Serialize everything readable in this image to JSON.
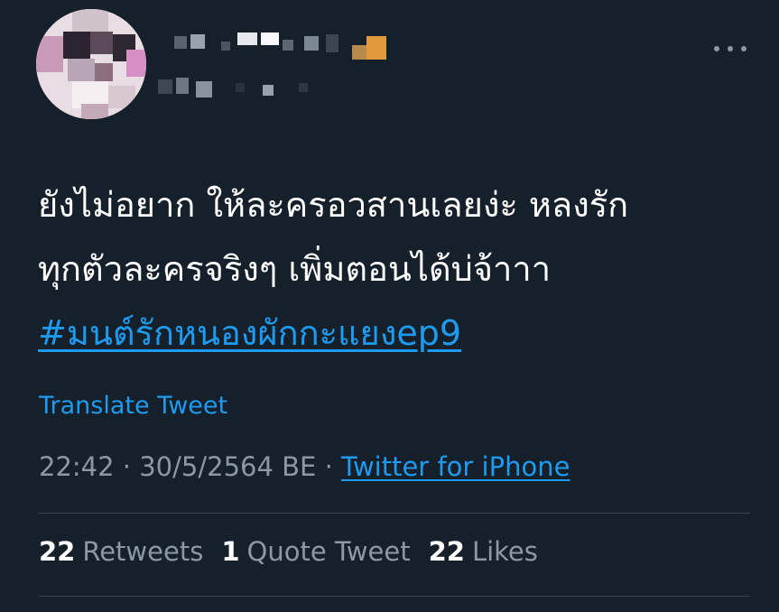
{
  "tweet": {
    "text_lines": [
      "ยังไม่อยาก ให้ละครอวสานเลยง่ะ หลงรัก",
      "ทุกตัวละครจริงๆ เพิ่มตอนได้บ่จ้าาา"
    ],
    "hashtag": "#มนต์รักหนองผักกะแยงep9"
  },
  "translate_label": "Translate Tweet",
  "meta": {
    "time": "22:42",
    "sep1": " · ",
    "date": "30/5/2564 BE",
    "sep2": " · ",
    "source": "Twitter for iPhone"
  },
  "stats": {
    "retweets_count": "22",
    "retweets_label": "Retweets",
    "quotes_count": "1",
    "quotes_label": "Quote Tweet",
    "likes_count": "22",
    "likes_label": "Likes"
  },
  "icons": {
    "more": "more-horizontal-icon"
  },
  "colors": {
    "background": "#15202b",
    "text": "#ffffff",
    "secondary_text": "#8b98a5",
    "link": "#1d9bf0",
    "divider": "#38444d"
  }
}
